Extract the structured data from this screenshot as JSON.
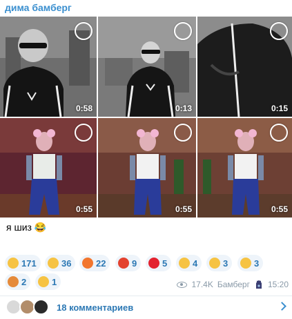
{
  "channel": {
    "name": "дима бамберг"
  },
  "media": [
    {
      "duration": "0:58",
      "tone": "bw"
    },
    {
      "duration": "0:13",
      "tone": "bw"
    },
    {
      "duration": "0:15",
      "tone": "bw"
    },
    {
      "duration": "0:55",
      "tone": "color"
    },
    {
      "duration": "0:55",
      "tone": "color"
    },
    {
      "duration": "0:55",
      "tone": "color"
    }
  ],
  "caption": {
    "text": "я шиз 😂"
  },
  "reactions": [
    {
      "icon": "grinning-face-icon",
      "count": "171",
      "color": "#f6c343"
    },
    {
      "icon": "thumbs-up-icon",
      "count": "36",
      "color": "#f6c343"
    },
    {
      "icon": "fire-icon",
      "count": "22",
      "color": "#f2762e"
    },
    {
      "icon": "angry-face-icon",
      "count": "9",
      "color": "#e3422f"
    },
    {
      "icon": "red-heart-icon",
      "count": "5",
      "color": "#e3222f"
    },
    {
      "icon": "clapping-hands-icon",
      "count": "4",
      "color": "#f6c343"
    },
    {
      "icon": "thinking-face-icon",
      "count": "3",
      "color": "#f6c343"
    },
    {
      "icon": "star-struck-icon",
      "count": "3",
      "color": "#f6c343"
    },
    {
      "icon": "party-popper-icon",
      "count": "2",
      "color": "#e58a3a"
    },
    {
      "icon": "crying-face-icon",
      "count": "1",
      "color": "#f6c343"
    }
  ],
  "meta": {
    "views": "17.4K",
    "author": "Бамберг",
    "time": "15:20"
  },
  "comments": {
    "label": "18 комментариев"
  }
}
